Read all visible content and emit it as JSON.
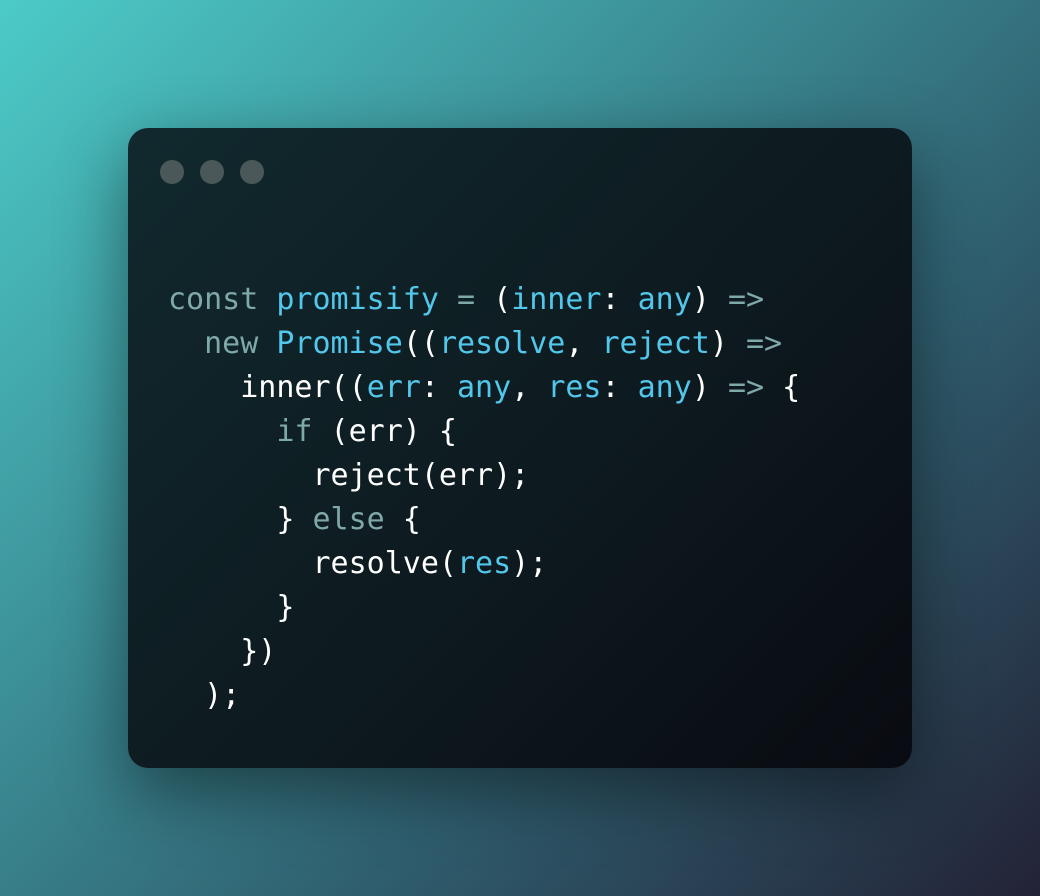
{
  "colors": {
    "background_start": "#4ccbc8",
    "background_end": "#232236",
    "window": "#0d1a1f",
    "window_dot": "#4a5859",
    "keyword": "#7fa8a8",
    "identifier": "#52c7ec",
    "plain": "#ffffff"
  },
  "window_controls": [
    "window-dot-1",
    "window-dot-2",
    "window-dot-3"
  ],
  "code": {
    "language": "typescript",
    "lines": [
      [
        {
          "t": "const",
          "c": "keyword"
        },
        {
          "t": " ",
          "c": "plain"
        },
        {
          "t": "promisify",
          "c": "identifier"
        },
        {
          "t": " ",
          "c": "plain"
        },
        {
          "t": "=",
          "c": "keyword"
        },
        {
          "t": " (",
          "c": "plain"
        },
        {
          "t": "inner",
          "c": "identifier"
        },
        {
          "t": ": ",
          "c": "plain"
        },
        {
          "t": "any",
          "c": "identifier"
        },
        {
          "t": ") ",
          "c": "plain"
        },
        {
          "t": "=>",
          "c": "keyword"
        }
      ],
      [
        {
          "t": "  ",
          "c": "plain"
        },
        {
          "t": "new",
          "c": "keyword"
        },
        {
          "t": " ",
          "c": "plain"
        },
        {
          "t": "Promise",
          "c": "identifier"
        },
        {
          "t": "((",
          "c": "plain"
        },
        {
          "t": "resolve",
          "c": "identifier"
        },
        {
          "t": ", ",
          "c": "plain"
        },
        {
          "t": "reject",
          "c": "identifier"
        },
        {
          "t": ") ",
          "c": "plain"
        },
        {
          "t": "=>",
          "c": "keyword"
        }
      ],
      [
        {
          "t": "    inner((",
          "c": "plain"
        },
        {
          "t": "err",
          "c": "identifier"
        },
        {
          "t": ": ",
          "c": "plain"
        },
        {
          "t": "any",
          "c": "identifier"
        },
        {
          "t": ", ",
          "c": "plain"
        },
        {
          "t": "res",
          "c": "identifier"
        },
        {
          "t": ": ",
          "c": "plain"
        },
        {
          "t": "any",
          "c": "identifier"
        },
        {
          "t": ") ",
          "c": "plain"
        },
        {
          "t": "=>",
          "c": "keyword"
        },
        {
          "t": " {",
          "c": "plain"
        }
      ],
      [
        {
          "t": "      ",
          "c": "plain"
        },
        {
          "t": "if",
          "c": "keyword"
        },
        {
          "t": " (err) {",
          "c": "plain"
        }
      ],
      [
        {
          "t": "        reject(err);",
          "c": "plain"
        }
      ],
      [
        {
          "t": "      } ",
          "c": "plain"
        },
        {
          "t": "else",
          "c": "keyword"
        },
        {
          "t": " {",
          "c": "plain"
        }
      ],
      [
        {
          "t": "        resolve(",
          "c": "plain"
        },
        {
          "t": "res",
          "c": "identifier"
        },
        {
          "t": ");",
          "c": "plain"
        }
      ],
      [
        {
          "t": "      }",
          "c": "plain"
        }
      ],
      [
        {
          "t": "    })",
          "c": "plain"
        }
      ],
      [
        {
          "t": "  );",
          "c": "plain"
        }
      ]
    ]
  }
}
